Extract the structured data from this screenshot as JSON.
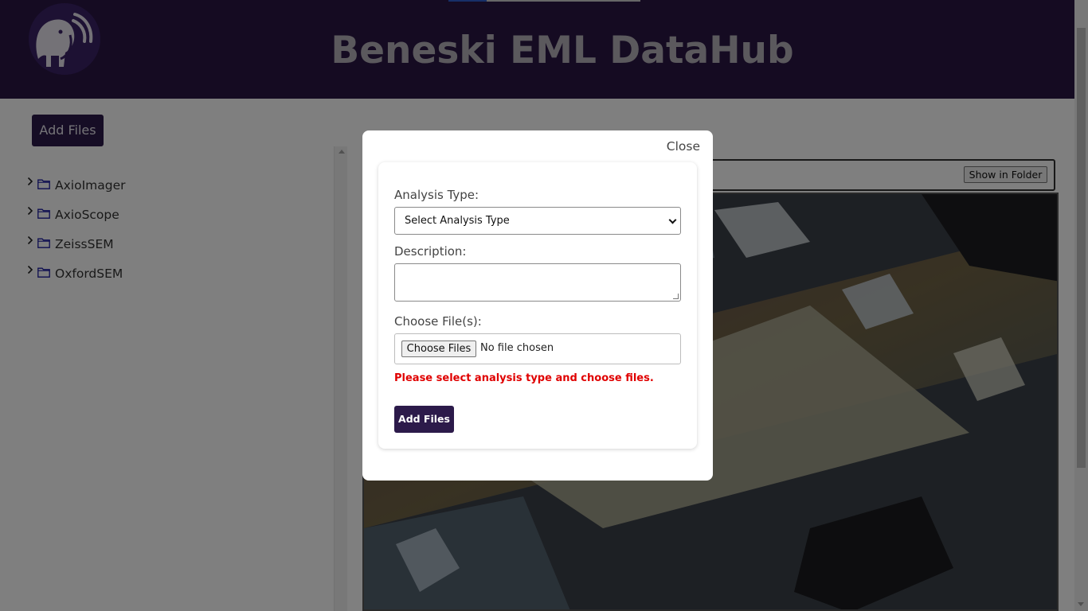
{
  "header": {
    "title": "Beneski EML DataHub",
    "logo_icon": "mammoth-logo-icon",
    "loading_progress": 0.2
  },
  "sidebar": {
    "add_files_label": "Add Files",
    "folders": [
      {
        "label": "AxioImager",
        "icon": "folder-icon"
      },
      {
        "label": "AxioScope",
        "icon": "folder-icon"
      },
      {
        "label": "ZeissSEM",
        "icon": "folder-icon"
      },
      {
        "label": "OxfordSEM",
        "icon": "folder-icon"
      }
    ]
  },
  "main": {
    "show_in_folder_label": "Show in Folder"
  },
  "modal": {
    "close_label": "Close",
    "analysis_type_label": "Analysis Type:",
    "analysis_type_selected": "Select Analysis Type",
    "description_label": "Description:",
    "description_value": "",
    "choose_files_label": "Choose File(s):",
    "choose_files_button": "Choose Files",
    "no_file_text": "No file chosen",
    "error_text": "Please select analysis type and choose files.",
    "add_files_label": "Add Files"
  },
  "colors": {
    "header_bg": "#2a1744",
    "brand_button": "#2c1a4a",
    "folder_icon": "#1a1aa0",
    "error": "#e00000"
  }
}
